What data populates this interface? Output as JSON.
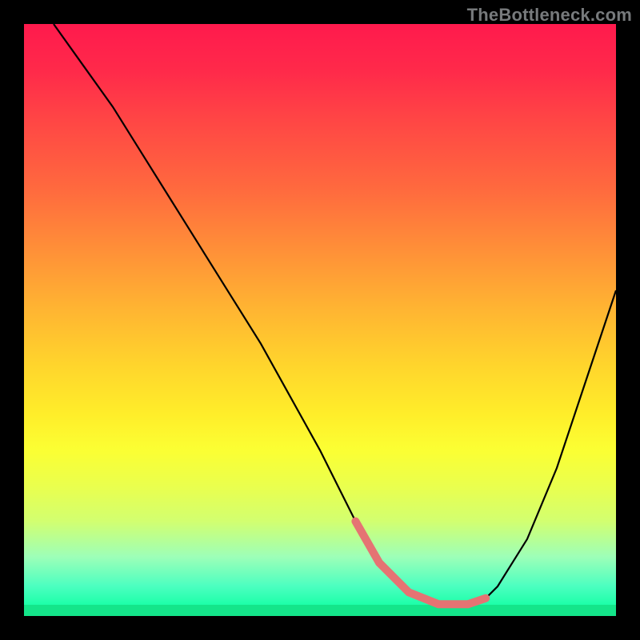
{
  "watermark": "TheBottleneck.com",
  "colors": {
    "background": "#000000",
    "watermark_text": "#777a7c",
    "curve": "#000000",
    "highlight_segment": "#e57373",
    "gradient_top": "#ff1a4d",
    "gradient_bottom": "#14f59a"
  },
  "chart_data": {
    "type": "line",
    "title": "",
    "xlabel": "",
    "ylabel": "",
    "xlim": [
      0,
      100
    ],
    "ylim": [
      0,
      100
    ],
    "grid": false,
    "legend": false,
    "description": "V-shaped bottleneck curve with rainbow heatmap background (red at top = high bottleneck, green at bottom = low bottleneck). Black curve descends from upper-left to a flat minimum near the bottom-center-right, then rises toward upper-right. The flat minimum region is overlaid with a thick salmon segment denoting the optimal range.",
    "series": [
      {
        "name": "bottleneck-curve",
        "color": "#000000",
        "x": [
          5,
          10,
          15,
          20,
          25,
          30,
          35,
          40,
          45,
          50,
          53,
          56,
          60,
          65,
          70,
          75,
          78,
          80,
          85,
          90,
          95,
          100
        ],
        "y": [
          100,
          93,
          86,
          78,
          70,
          62,
          54,
          46,
          37,
          28,
          22,
          16,
          9,
          4,
          2,
          2,
          3,
          5,
          13,
          25,
          40,
          55
        ]
      },
      {
        "name": "optimal-range-highlight",
        "color": "#e57373",
        "x": [
          56,
          60,
          65,
          70,
          75,
          78
        ],
        "y": [
          16,
          9,
          4,
          2,
          2,
          3
        ]
      }
    ],
    "annotations": []
  }
}
